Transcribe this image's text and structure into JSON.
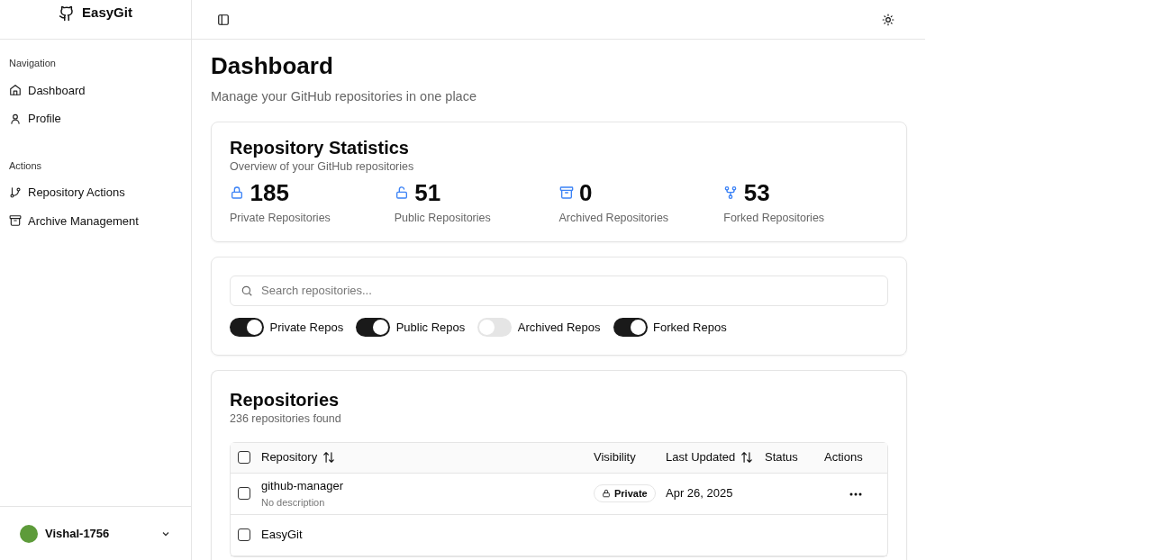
{
  "brand": "EasyGit",
  "sidebar": {
    "groups": [
      {
        "label": "Navigation",
        "items": [
          {
            "label": "Dashboard"
          },
          {
            "label": "Profile"
          }
        ]
      },
      {
        "label": "Actions",
        "items": [
          {
            "label": "Repository Actions"
          },
          {
            "label": "Archive Management"
          }
        ]
      }
    ],
    "user": {
      "name": "Vishal-1756"
    }
  },
  "page": {
    "title": "Dashboard",
    "subtitle": "Manage your GitHub repositories in one place"
  },
  "stats": {
    "title": "Repository Statistics",
    "subtitle": "Overview of your GitHub repositories",
    "items": [
      {
        "value": "185",
        "label": "Private Repositories"
      },
      {
        "value": "51",
        "label": "Public Repositories"
      },
      {
        "value": "0",
        "label": "Archived Repositories"
      },
      {
        "value": "53",
        "label": "Forked Repositories"
      }
    ]
  },
  "filters": {
    "search": {
      "placeholder": "Search repositories..."
    },
    "toggles": [
      {
        "label": "Private Repos",
        "on": true
      },
      {
        "label": "Public Repos",
        "on": true
      },
      {
        "label": "Archived Repos",
        "on": false
      },
      {
        "label": "Forked Repos",
        "on": true
      }
    ]
  },
  "repositories": {
    "title": "Repositories",
    "count": "236 repositories found",
    "columns": [
      {
        "label": "Repository",
        "sortable": true
      },
      {
        "label": "Visibility",
        "sortable": false
      },
      {
        "label": "Last Updated",
        "sortable": true
      },
      {
        "label": "Status",
        "sortable": false
      },
      {
        "label": "Actions",
        "sortable": false
      }
    ],
    "header_checked": false,
    "rows": [
      {
        "name": "github-manager",
        "description": "No description",
        "visibility": "Private",
        "updated": "Apr 26, 2025",
        "checked": false
      },
      {
        "name": "EasyGit",
        "checked": false
      }
    ]
  }
}
